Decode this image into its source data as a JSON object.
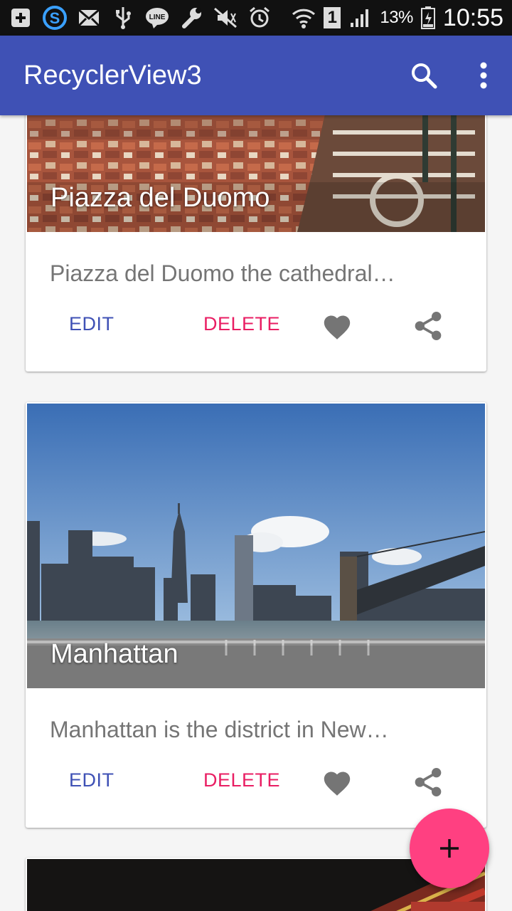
{
  "status_bar": {
    "battery_percent": "13%",
    "sim_slot": "1",
    "time": "10:55",
    "icons": [
      "add-box-icon",
      "skype-icon",
      "mail-icon",
      "usb-icon",
      "line-app-icon",
      "wrench-icon",
      "mute-icon",
      "alarm-icon",
      "wifi-icon",
      "sim-icon",
      "signal-icon",
      "battery-icon"
    ]
  },
  "app_bar": {
    "title": "RecyclerView3",
    "actions": [
      "search-icon",
      "overflow-menu-icon"
    ],
    "color": "#3f51b5"
  },
  "cards": [
    {
      "title": "Piazza del Duomo",
      "description": "Piazza del Duomo the cathedral…",
      "edit_label": "EDIT",
      "delete_label": "DELETE"
    },
    {
      "title": "Manhattan",
      "description": "Manhattan is the district in New…",
      "edit_label": "EDIT",
      "delete_label": "DELETE"
    }
  ],
  "colors": {
    "primary": "#3f51b5",
    "accent": "#ff4081",
    "delete_text": "#e91e63",
    "icon_gray": "#757575"
  },
  "fab": {
    "icon": "add-icon"
  }
}
